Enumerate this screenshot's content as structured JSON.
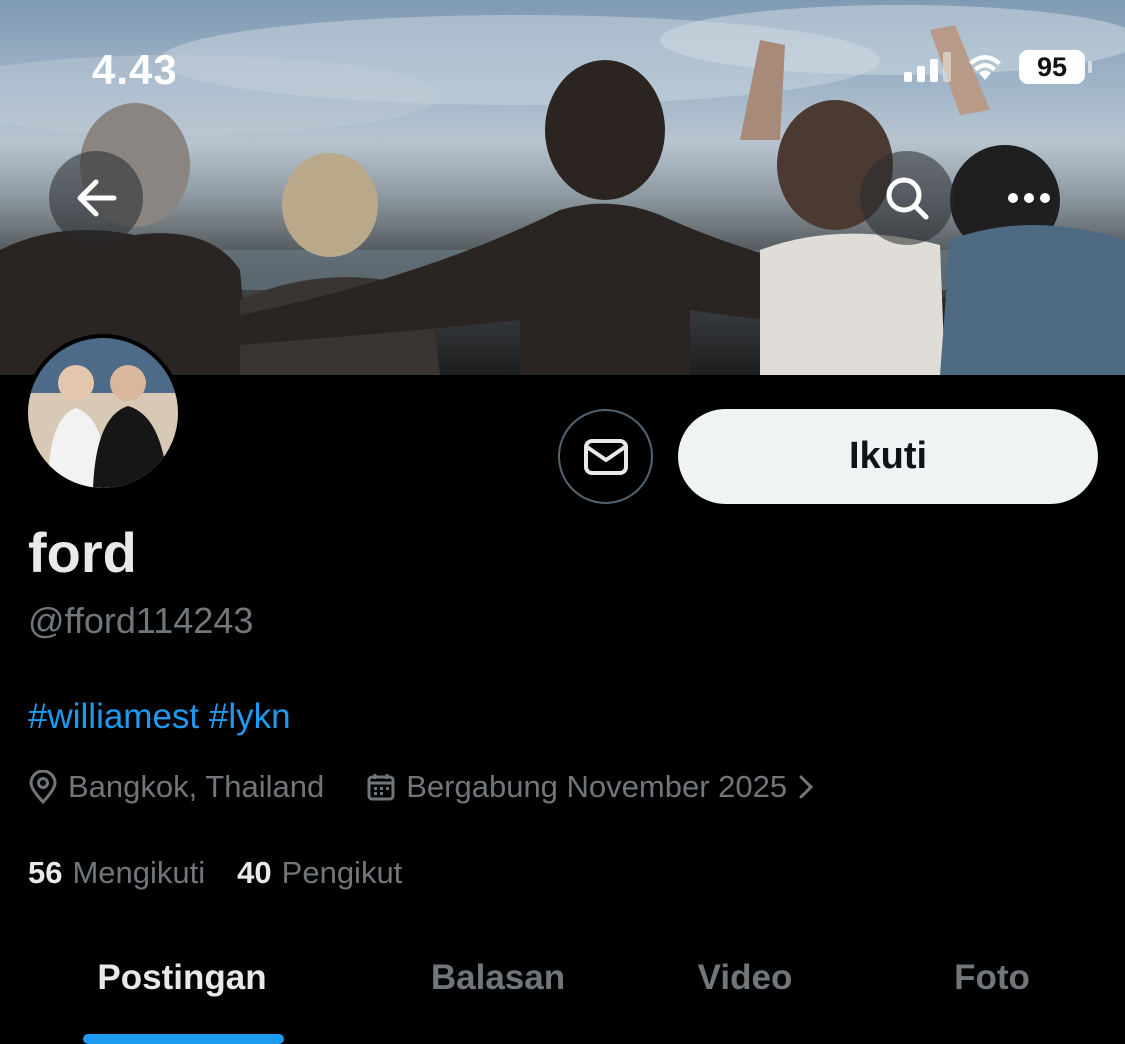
{
  "status_bar": {
    "time": "4.43",
    "battery": "95"
  },
  "nav": {
    "back_icon": "arrow-left-icon",
    "search_icon": "search-icon",
    "more_icon": "more-horizontal-icon"
  },
  "profile": {
    "display_name": "ford",
    "handle": "@fford114243",
    "bio": "#williamest #lykn",
    "location": "Bangkok, Thailand",
    "joined": "Bergabung November 2025",
    "following_count": "56",
    "following_label": "Mengikuti",
    "followers_count": "40",
    "followers_label": "Pengikut"
  },
  "actions": {
    "follow_label": "Ikuti",
    "message_icon": "mail-icon"
  },
  "tabs": [
    {
      "label": "Postingan",
      "active": true
    },
    {
      "label": "Balasan",
      "active": false
    },
    {
      "label": "Video",
      "active": false
    },
    {
      "label": "Foto",
      "active": false
    }
  ],
  "colors": {
    "accent": "#1d9bf0",
    "background": "#000000",
    "muted": "#71767b",
    "follow_bg": "#eff3f4"
  }
}
